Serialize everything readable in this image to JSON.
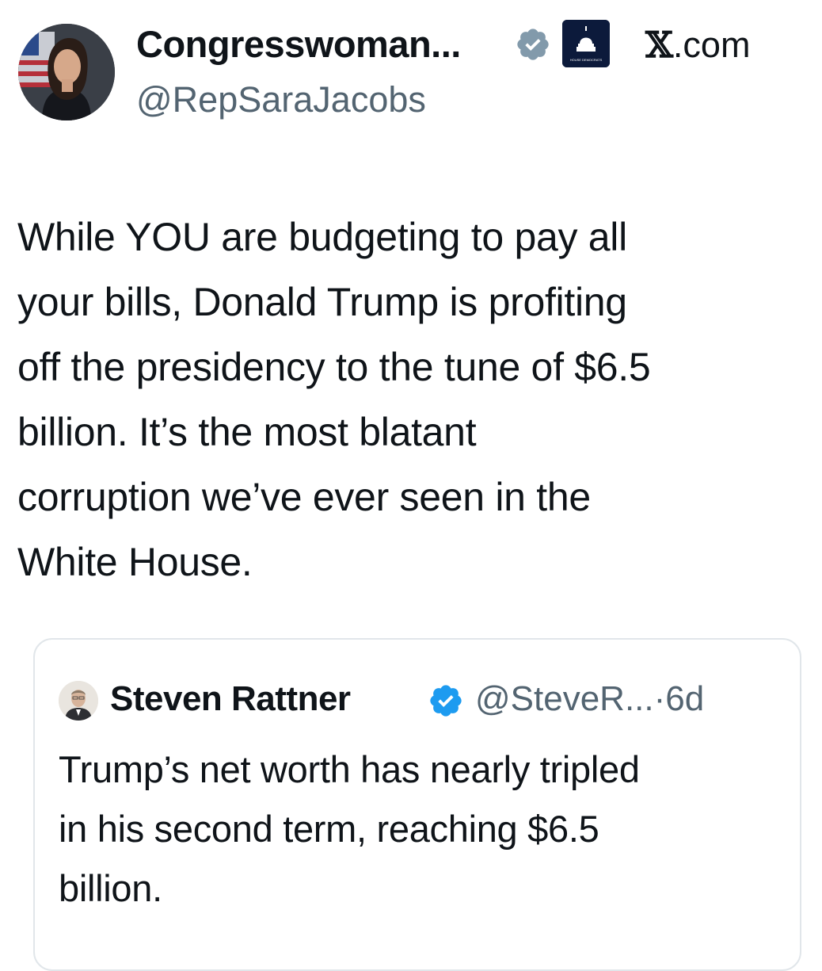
{
  "author": {
    "display_name": "Congresswoman...",
    "handle": "@RepSaraJacobs",
    "avatar_icon": "profile-photo",
    "verified_icon": "verified-badge-gray-icon",
    "affiliation_icon": "house-democrats-logo",
    "affiliation_logo_text": "HOUSE DEMOCRATS"
  },
  "platform_label": "X.com",
  "tweet": {
    "lines": [
      "While YOU are budgeting to pay all",
      "your bills, Donald Trump is profiting",
      "off the presidency to the tune of $6.5",
      "billion. It’s the most blatant",
      "corruption we’ve ever seen in the",
      "White House."
    ]
  },
  "quote": {
    "display_name": "Steven Rattner",
    "handle": "@SteveR...",
    "separator": "·",
    "age": "6d",
    "verified_icon": "verified-badge-blue-icon",
    "lines": [
      "Trump’s net worth has nearly tripled",
      "in his second term, reaching $6.5",
      "billion."
    ]
  },
  "colors": {
    "text": "#0f1419",
    "secondary": "#536471",
    "verified_blue": "#1d9bf0",
    "verified_gray": "#829aab",
    "card_border": "#e1e6ea"
  }
}
